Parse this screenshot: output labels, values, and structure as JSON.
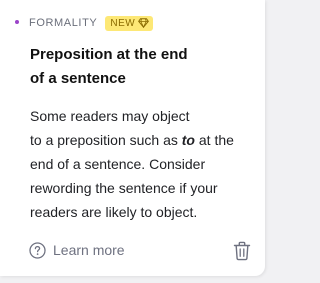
{
  "card": {
    "category": "FORMALITY",
    "badge": "NEW",
    "title_line1": "Preposition at the end",
    "title_line2": "of a sentence",
    "body": {
      "line1": "Some readers may object",
      "line2_before": "to a preposition such as ",
      "line2_emphasis": "to",
      "line2_after": " at the",
      "line3": "end of a sentence. Consider",
      "line4": "rewording the sentence if your",
      "line5": "readers are likely to object."
    },
    "learn_more_label": "Learn more",
    "icons": {
      "category_dot": "dot-icon",
      "badge_icon": "gem-icon",
      "help_icon": "question-circle-icon",
      "delete_icon": "trash-icon"
    }
  },
  "colors": {
    "accent_dot": "#9b44c9",
    "badge_background": "#fde876",
    "muted_text": "#6e7180"
  }
}
